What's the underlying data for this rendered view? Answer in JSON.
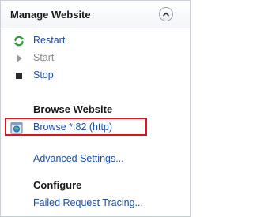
{
  "panel": {
    "title": "Manage Website",
    "collapse_icon": "chevron-up-icon"
  },
  "actions": {
    "restart": {
      "label": "Restart",
      "icon": "restart-icon",
      "state": "enabled"
    },
    "start": {
      "label": "Start",
      "icon": "start-icon",
      "state": "disabled"
    },
    "stop": {
      "label": "Stop",
      "icon": "stop-icon",
      "state": "enabled"
    }
  },
  "browse_section": {
    "heading": "Browse Website",
    "browse_link": {
      "label": "Browse *:82 (http)",
      "icon": "browse-web-icon"
    }
  },
  "advanced": {
    "label": "Advanced Settings..."
  },
  "configure_section": {
    "heading": "Configure",
    "failed_request": {
      "label": "Failed Request Tracing..."
    }
  },
  "colors": {
    "link": "#1d4fa0",
    "disabled": "#8a8a8a",
    "highlight": "#e0141c",
    "restart_green": "#2e9a3a"
  }
}
